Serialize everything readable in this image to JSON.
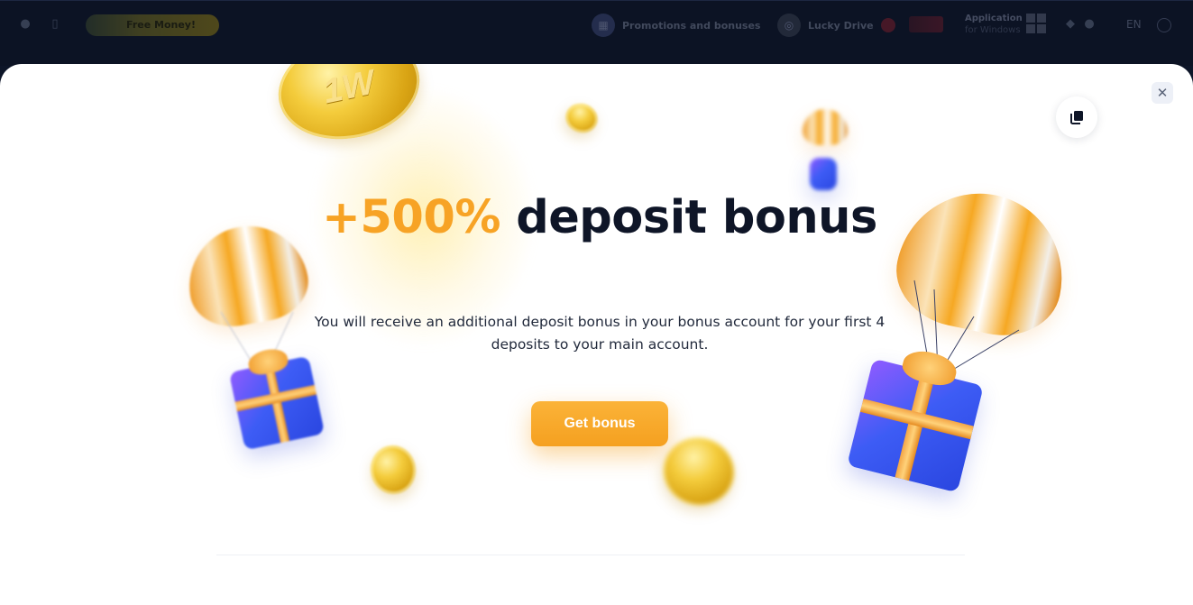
{
  "top_nav": {
    "free_money_label": "Free Money!",
    "promotions_label": "Promotions and bonuses",
    "lucky_drive_label": "Lucky Drive",
    "application_label": "Application",
    "application_sub": "for Windows",
    "language": "EN"
  },
  "modal": {
    "close_icon": "close-icon",
    "copy_icon": "copy-icon",
    "headline_accent": "+500%",
    "headline_rest": " deposit bonus",
    "description": "You will receive an additional deposit bonus in your bonus account for your first 4 deposits to your main account.",
    "cta_label": "Get bonus",
    "coin_mark": "1W"
  },
  "colors": {
    "accent": "#f7a325",
    "headline": "#0e1527",
    "modal_bg": "#ffffff",
    "page_bg": "#0d1528"
  }
}
